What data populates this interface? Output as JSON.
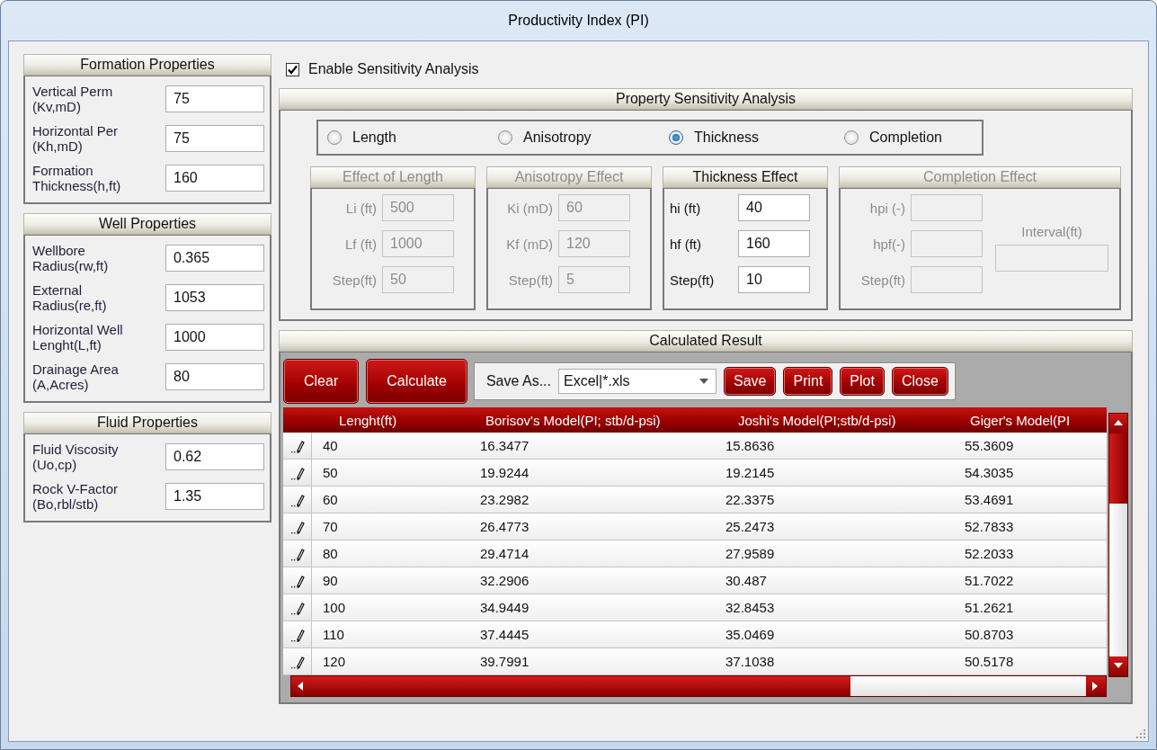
{
  "window": {
    "title": "Productivity Index (PI)"
  },
  "left_groups": [
    {
      "title": "Formation Properties",
      "fields": [
        {
          "label": "Vertical Perm\n(Kv,mD)",
          "value": "75"
        },
        {
          "label": "Horizontal Per\n(Kh,mD)",
          "value": "75"
        },
        {
          "label": "Formation\nThickness(h,ft)",
          "value": "160"
        }
      ]
    },
    {
      "title": "Well Properties",
      "fields": [
        {
          "label": "Wellbore\nRadius(rw,ft)",
          "value": "0.365"
        },
        {
          "label": "External\nRadius(re,ft)",
          "value": "1053"
        },
        {
          "label": "Horizontal Well\nLenght(L,ft)",
          "value": "1000"
        },
        {
          "label": "Drainage Area\n(A,Acres)",
          "value": "80"
        }
      ]
    },
    {
      "title": "Fluid Properties",
      "fields": [
        {
          "label": "Fluid Viscosity\n(Uo,cp)",
          "value": "0.62"
        },
        {
          "label": "Rock V-Factor\n(Bo,rbl/stb)",
          "value": "1.35"
        }
      ]
    }
  ],
  "sensitivity": {
    "label": "Enable Sensitivity Analysis",
    "checked": true
  },
  "property_panel": {
    "title": "Property Sensitivity Analysis",
    "options": [
      {
        "label": "Length",
        "selected": false
      },
      {
        "label": "Anisotropy",
        "selected": false
      },
      {
        "label": "Thickness",
        "selected": true
      },
      {
        "label": "Completion",
        "selected": false
      }
    ],
    "effects": [
      {
        "title": "Effect of Length",
        "disabled": true,
        "fields": [
          {
            "label": "Li (ft)",
            "value": "500"
          },
          {
            "label": "Lf (ft)",
            "value": "1000"
          },
          {
            "label": "Step(ft)",
            "value": "50"
          }
        ]
      },
      {
        "title": "Anisotropy Effect",
        "disabled": true,
        "fields": [
          {
            "label": "Ki (mD)",
            "value": "60"
          },
          {
            "label": "Kf (mD)",
            "value": "120"
          },
          {
            "label": "Step(ft)",
            "value": "5"
          }
        ]
      },
      {
        "title": "Thickness Effect",
        "disabled": false,
        "fields": [
          {
            "label": "hi (ft)",
            "value": "40"
          },
          {
            "label": "hf (ft)",
            "value": "160"
          },
          {
            "label": "Step(ft)",
            "value": "10"
          }
        ]
      },
      {
        "title": "Completion Effect",
        "disabled": true,
        "fields": [
          {
            "label": "hpi (-)"
          },
          {
            "label": "hpf(-)"
          },
          {
            "label": "Step(ft)"
          }
        ],
        "side_field": {
          "label": "Interval(ft)"
        }
      }
    ]
  },
  "results": {
    "title": "Calculated Result",
    "buttons": [
      "Clear",
      "Calculate"
    ],
    "save_as": {
      "label": "Save As...",
      "value": "Excel|*.xls"
    },
    "action_buttons": [
      "Save",
      "Print",
      "Plot",
      "Close"
    ],
    "table": {
      "columns": [
        "Lenght(ft)",
        "Borisov's Model(PI; stb/d-psi)",
        "Joshi's Model(PI;stb/d-psi)",
        "Giger's Model(PI"
      ],
      "rows": [
        {
          "cells": [
            "40",
            "16.3477",
            "15.8636",
            "55.3609"
          ]
        },
        {
          "cells": [
            "50",
            "19.9244",
            "19.2145",
            "54.3035"
          ]
        },
        {
          "cells": [
            "60",
            "23.2982",
            "22.3375",
            "53.4691"
          ]
        },
        {
          "cells": [
            "70",
            "26.4773",
            "25.2473",
            "52.7833"
          ]
        },
        {
          "cells": [
            "80",
            "29.4714",
            "27.9589",
            "52.2033"
          ]
        },
        {
          "cells": [
            "90",
            "32.2906",
            "30.487",
            "51.7022"
          ]
        },
        {
          "cells": [
            "100",
            "34.9449",
            "32.8453",
            "51.2621"
          ]
        },
        {
          "cells": [
            "110",
            "37.4445",
            "35.0469",
            "50.8703"
          ]
        },
        {
          "cells": [
            "120",
            "39.7991",
            "37.1038",
            "50.5178"
          ]
        }
      ]
    }
  }
}
